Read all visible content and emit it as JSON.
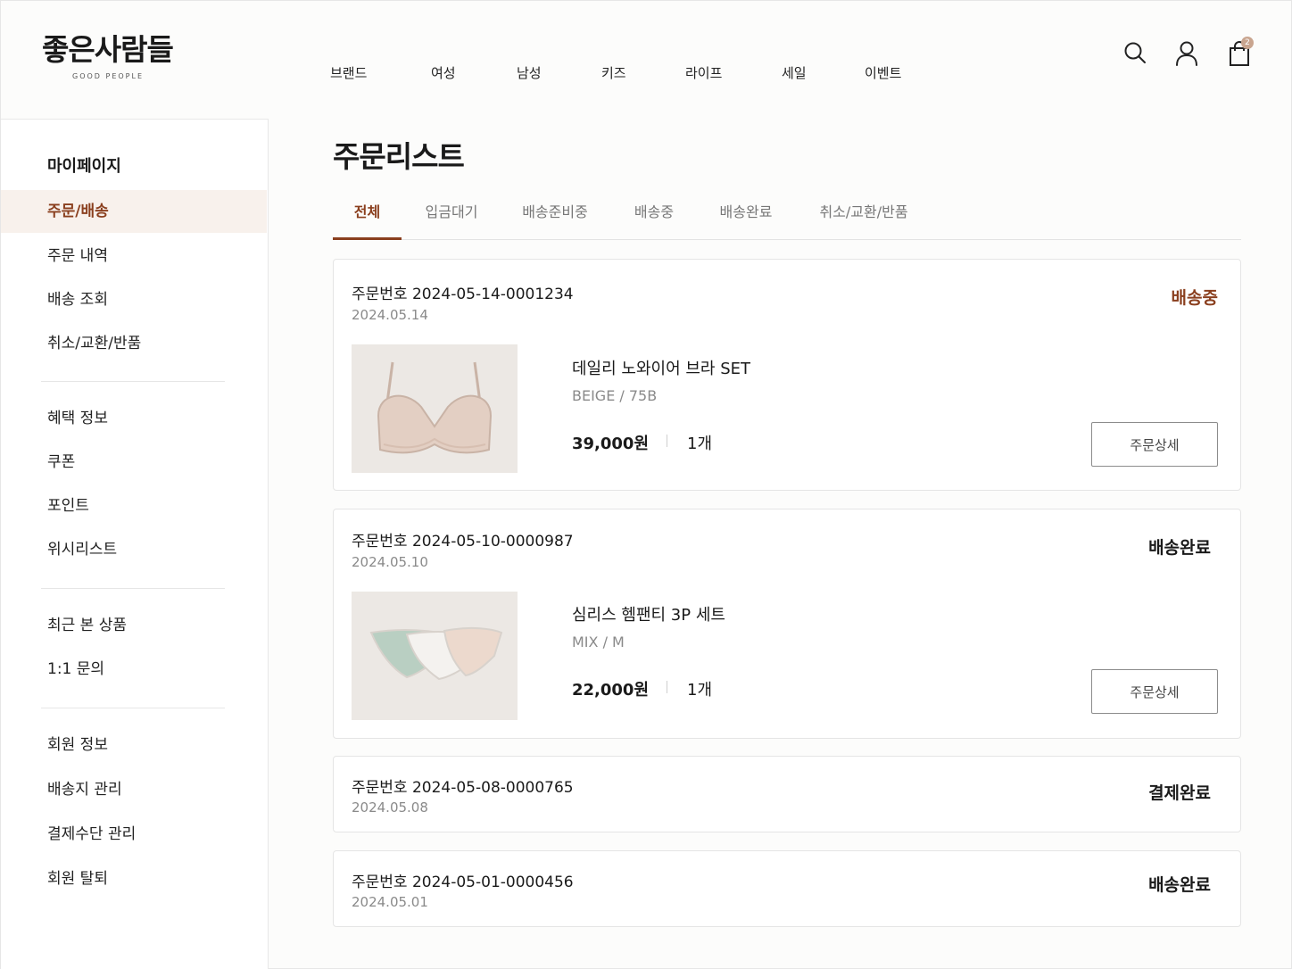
{
  "brand": {
    "name": "좋은사람들",
    "sub": "GOOD PEOPLE"
  },
  "nav": [
    "브랜드",
    "여성",
    "남성",
    "키즈",
    "라이프",
    "세일",
    "이벤트"
  ],
  "utility": {
    "cart_count": "2"
  },
  "sidebar": {
    "title": "마이페이지",
    "items": [
      "주문/배송",
      "주문 내역",
      "배송 조회",
      "취소/교환/반품",
      "혜택 정보",
      "쿠폰",
      "포인트",
      "위시리스트",
      "최근 본 상품",
      "1:1 문의",
      "회원 정보",
      "배송지 관리",
      "결제수단 관리",
      "회원 탈퇴"
    ],
    "active_item": "주문/배송"
  },
  "page": {
    "title": "주문리스트"
  },
  "tabs": [
    "전체",
    "입금대기",
    "배송준비중",
    "배송중",
    "배송완료",
    "취소/교환/반품"
  ],
  "active_tab": "전체",
  "orders": [
    {
      "order_no": "주문번호 2024-05-14-0001234",
      "date": "2024.05.14",
      "status": "배송중",
      "product": {
        "name": "데일리 노와이어 브라 SET",
        "option": "BEIGE / 75B",
        "price": "39,000원",
        "qty": "1개"
      },
      "detail_label": "주문상세"
    },
    {
      "order_no": "주문번호 2024-05-10-0000987",
      "date": "2024.05.10",
      "status": "배송완료",
      "product": {
        "name": "심리스 헴팬티 3P 세트",
        "option": "MIX / M",
        "price": "22,000원",
        "qty": "1개"
      },
      "detail_label": "주문상세"
    },
    {
      "order_no": "주문번호 2024-05-08-0000765",
      "date": "2024.05.08",
      "status": "결제완료"
    },
    {
      "order_no": "주문번호 2024-05-01-0000456",
      "date": "2024.05.01",
      "status": "배송완료"
    }
  ],
  "colors": {
    "accent": "#8a3f1e",
    "active_bg": "#f8f1ec",
    "badge": "#c9a58f"
  }
}
